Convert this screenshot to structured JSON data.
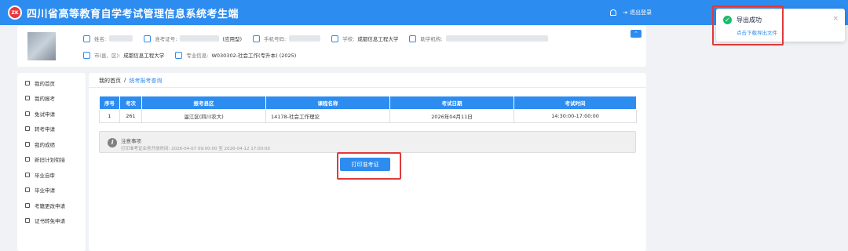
{
  "header": {
    "logo_text": "ZK",
    "title": "四川省高等教育自学考试管理信息系统考生端",
    "logout_label": "退出登录"
  },
  "profile": {
    "name_label": "姓名:",
    "ticket_label": "准考证号:",
    "ticket_suffix": "(应用型)",
    "phone_label": "手机号码:",
    "school_label": "学校:",
    "school_value": "成都信息工程大学",
    "org_label": "助学机构:",
    "city_label": "市(县、区):",
    "city_value": "成都信息工程大学",
    "major_label": "专业信息:",
    "major_value": "W030302-社会工作(专升本) (2025)",
    "collapse_symbol": "⌃"
  },
  "sidebar": {
    "items": [
      {
        "label": "我的首页",
        "icon": "home-icon"
      },
      {
        "label": "我的报考",
        "icon": "calendar-icon"
      },
      {
        "label": "免试申请",
        "icon": "document-icon"
      },
      {
        "label": "转考申请",
        "icon": "document-icon"
      },
      {
        "label": "我的成绩",
        "icon": "document-icon"
      },
      {
        "label": "新旧计划衔接",
        "icon": "exchange-icon"
      },
      {
        "label": "毕业自审",
        "icon": "document-icon"
      },
      {
        "label": "毕业申请",
        "icon": "user-icon"
      },
      {
        "label": "考籍更改申请",
        "icon": "edit-icon"
      },
      {
        "label": "证书转免申请",
        "icon": "document-icon"
      }
    ]
  },
  "breadcrumb": {
    "home": "我的首页",
    "separator": "/",
    "current": "统考报考查询"
  },
  "table": {
    "headers": [
      "序号",
      "考次",
      "报考县区",
      "课程名称",
      "考试日期",
      "考试时间"
    ],
    "rows": [
      [
        "1",
        "261",
        "温江区(四川农大)",
        "14178-社会工作理论",
        "2026年04月11日",
        "14:30:00-17:00:00"
      ]
    ]
  },
  "notice": {
    "icon_text": "i",
    "title": "注意事项",
    "text": "打印准考证业务开放时间: 2026-04-07 09:00:00 至 2026-04-12 17:00:00"
  },
  "print_button_label": "打印准考证",
  "toast": {
    "title": "导出成功",
    "link": "点击下载导出文件",
    "close": "×",
    "check": "✓"
  }
}
